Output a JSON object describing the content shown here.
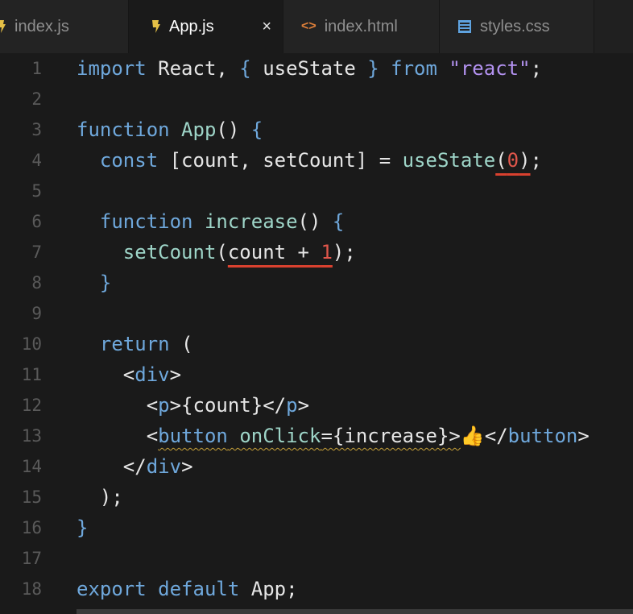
{
  "tabs": [
    {
      "label": "index.js",
      "icon": "js-file-icon"
    },
    {
      "label": "App.js",
      "icon": "js-file-icon",
      "active": true,
      "close": "×"
    },
    {
      "label": "index.html",
      "icon": "html-file-icon",
      "icon_glyph": "<>"
    },
    {
      "label": "styles.css",
      "icon": "css-file-icon"
    }
  ],
  "line_numbers": [
    "1",
    "2",
    "3",
    "4",
    "5",
    "6",
    "7",
    "8",
    "9",
    "10",
    "11",
    "12",
    "13",
    "14",
    "15",
    "16",
    "17",
    "18"
  ],
  "code": {
    "l1": {
      "kw1": "import",
      "t1": " React, ",
      "b1": "{",
      "t2": " useState ",
      "b2": "}",
      "kw2": " from ",
      "str": "\"react\"",
      "t3": ";"
    },
    "l3": {
      "kw": "function",
      "fn": " App",
      "t": "() ",
      "b": "{"
    },
    "l4": {
      "kw": "  const",
      "t1": " [count, setCount] = ",
      "fn": "useState",
      "t2": "(",
      "num": "0",
      "t3": ")",
      ";": ";"
    },
    "l6": {
      "kw": "  function",
      "fn": " increase",
      "t": "() ",
      "b": "{"
    },
    "l7": {
      "fn": "    setCount",
      "t1": "(",
      "t2": "count + ",
      "num": "1",
      "t3": ")",
      ";": ";"
    },
    "l8": {
      "b": "  }"
    },
    "l10": {
      "kw": "  return",
      "t": " ("
    },
    "l11": {
      "t1": "    <",
      "tag": "div",
      "t2": ">"
    },
    "l12": {
      "t1": "      <",
      "tag1": "p",
      "t2": ">{count}</",
      "tag2": "p",
      "t3": ">"
    },
    "l13": {
      "t1": "      <",
      "tag1": "button",
      "t2": " ",
      "attr": "onClick",
      "t3": "={increase}>",
      "emoji": "👍",
      "t4": "</",
      "tag2": "button",
      "t5": ">"
    },
    "l14": {
      "t1": "    </",
      "tag": "div",
      "t2": ">"
    },
    "l15": {
      "t": "  );"
    },
    "l16": {
      "b": "}"
    },
    "l18": {
      "kw": "export default",
      "t": " App;"
    }
  },
  "colors": {
    "background": "#1a1a1a",
    "keyword": "#6fa8dc",
    "function": "#9ed5c8",
    "string": "#b392f0",
    "number": "#e0564b",
    "error_underline": "#d9412f",
    "warning_squiggle": "#c8a23a"
  }
}
